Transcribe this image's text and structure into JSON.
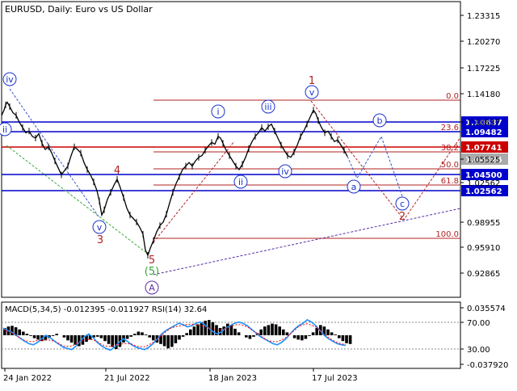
{
  "chart_data": [
    {
      "type": "line",
      "title": "EURUSD, Daily:  Euro vs US Dollar",
      "ylim": [
        0.91,
        1.248
      ],
      "y_ticks": [
        1.23315,
        1.2027,
        1.17225,
        1.1418,
        1.0063,
        1.05525,
        1.0248,
        0.98955,
        0.9591,
        0.92865
      ],
      "y_tick_labels": [
        "1.23315",
        "1.20270",
        "1.17225",
        "1.14180",
        "1.10637",
        "1.05525",
        "1.02562",
        "0.98955",
        "0.95910",
        "0.92865"
      ],
      "price_lines": [
        {
          "label": "1.10637",
          "value": 1.10637,
          "color": "#0000cc"
        },
        {
          "label": "1.09482",
          "value": 1.09482,
          "color": "#0000cc"
        },
        {
          "label": "1.07741",
          "value": 1.07741,
          "color": "#cc0000"
        },
        {
          "label": "1.06525",
          "value": 1.06525,
          "color": "#aaaaaa"
        },
        {
          "label": "1.04500",
          "value": 1.045,
          "color": "#0000cc"
        },
        {
          "label": "1.02562",
          "value": 1.02562,
          "color": "#0000cc"
        }
      ],
      "fib_levels": [
        {
          "label": "0.0",
          "value": 1.1275
        },
        {
          "label": "23.6",
          "value": 1.0915
        },
        {
          "label": "38.2",
          "value": 1.069
        },
        {
          "label": "50.0",
          "value": 1.051
        },
        {
          "label": "61.8",
          "value": 1.033
        },
        {
          "label": "100.0",
          "value": 0.974
        }
      ],
      "x_tick_labels": [
        "24 Jan 2022",
        "21 Jul 2022",
        "18 Jan 2023",
        "17 Jul 2023"
      ],
      "wave_labels": [
        {
          "text": "iv",
          "style": "circle-blue"
        },
        {
          "text": "ii",
          "style": "circle-blue"
        },
        {
          "text": "v",
          "style": "circle-blue"
        },
        {
          "text": "3",
          "style": "red"
        },
        {
          "text": "4",
          "style": "red"
        },
        {
          "text": "5",
          "style": "red"
        },
        {
          "text": "(5)",
          "style": "green"
        },
        {
          "text": "A",
          "style": "circle-purple"
        },
        {
          "text": "i",
          "style": "circle-blue"
        },
        {
          "text": "iii",
          "style": "circle-blue"
        },
        {
          "text": "ii",
          "style": "circle-blue"
        },
        {
          "text": "iv",
          "style": "circle-blue"
        },
        {
          "text": "v",
          "style": "circle-blue"
        },
        {
          "text": "1",
          "style": "red"
        },
        {
          "text": "a",
          "style": "circle-blue"
        },
        {
          "text": "b",
          "style": "circle-blue"
        },
        {
          "text": "c",
          "style": "circle-blue"
        },
        {
          "text": "2",
          "style": "red"
        }
      ],
      "price_path": [
        {
          "x": 0,
          "y": 1.118
        },
        {
          "x": 3,
          "y": 1.124
        },
        {
          "x": 5,
          "y": 1.13
        },
        {
          "x": 7,
          "y": 1.133
        },
        {
          "x": 10,
          "y": 1.128
        },
        {
          "x": 14,
          "y": 1.121
        },
        {
          "x": 18,
          "y": 1.118
        },
        {
          "x": 22,
          "y": 1.11
        },
        {
          "x": 26,
          "y": 1.104
        },
        {
          "x": 30,
          "y": 1.098
        },
        {
          "x": 34,
          "y": 1.1
        },
        {
          "x": 38,
          "y": 1.094
        },
        {
          "x": 42,
          "y": 1.092
        },
        {
          "x": 46,
          "y": 1.097
        },
        {
          "x": 50,
          "y": 1.086
        },
        {
          "x": 54,
          "y": 1.079
        },
        {
          "x": 58,
          "y": 1.082
        },
        {
          "x": 62,
          "y": 1.075
        },
        {
          "x": 66,
          "y": 1.066
        },
        {
          "x": 70,
          "y": 1.058
        },
        {
          "x": 74,
          "y": 1.05
        },
        {
          "x": 78,
          "y": 1.055
        },
        {
          "x": 82,
          "y": 1.06
        },
        {
          "x": 86,
          "y": 1.072
        },
        {
          "x": 90,
          "y": 1.082
        },
        {
          "x": 94,
          "y": 1.079
        },
        {
          "x": 98,
          "y": 1.075
        },
        {
          "x": 102,
          "y": 1.064
        },
        {
          "x": 106,
          "y": 1.056
        },
        {
          "x": 110,
          "y": 1.05
        },
        {
          "x": 114,
          "y": 1.042
        },
        {
          "x": 118,
          "y": 1.032
        },
        {
          "x": 121,
          "y": 1.02
        },
        {
          "x": 124,
          "y": 1.004
        },
        {
          "x": 127,
          "y": 1.01
        },
        {
          "x": 131,
          "y": 1.022
        },
        {
          "x": 135,
          "y": 1.03
        },
        {
          "x": 139,
          "y": 1.038
        },
        {
          "x": 143,
          "y": 1.045
        },
        {
          "x": 147,
          "y": 1.035
        },
        {
          "x": 151,
          "y": 1.024
        },
        {
          "x": 155,
          "y": 1.012
        },
        {
          "x": 159,
          "y": 1.004
        },
        {
          "x": 163,
          "y": 1.0
        },
        {
          "x": 167,
          "y": 0.996
        },
        {
          "x": 171,
          "y": 0.99
        },
        {
          "x": 175,
          "y": 0.982
        },
        {
          "x": 178,
          "y": 0.964
        },
        {
          "x": 181,
          "y": 0.958
        },
        {
          "x": 184,
          "y": 0.966
        },
        {
          "x": 188,
          "y": 0.975
        },
        {
          "x": 192,
          "y": 0.985
        },
        {
          "x": 196,
          "y": 0.992
        },
        {
          "x": 200,
          "y": 0.996
        },
        {
          "x": 204,
          "y": 1.005
        },
        {
          "x": 208,
          "y": 1.018
        },
        {
          "x": 212,
          "y": 1.03
        },
        {
          "x": 216,
          "y": 1.04
        },
        {
          "x": 220,
          "y": 1.048
        },
        {
          "x": 224,
          "y": 1.056
        },
        {
          "x": 228,
          "y": 1.06
        },
        {
          "x": 232,
          "y": 1.064
        },
        {
          "x": 236,
          "y": 1.06
        },
        {
          "x": 240,
          "y": 1.066
        },
        {
          "x": 244,
          "y": 1.07
        },
        {
          "x": 248,
          "y": 1.072
        },
        {
          "x": 252,
          "y": 1.078
        },
        {
          "x": 256,
          "y": 1.083
        },
        {
          "x": 260,
          "y": 1.087
        },
        {
          "x": 264,
          "y": 1.085
        },
        {
          "x": 268,
          "y": 1.094
        },
        {
          "x": 271,
          "y": 1.092
        },
        {
          "x": 274,
          "y": 1.086
        },
        {
          "x": 278,
          "y": 1.078
        },
        {
          "x": 282,
          "y": 1.072
        },
        {
          "x": 286,
          "y": 1.066
        },
        {
          "x": 290,
          "y": 1.06
        },
        {
          "x": 294,
          "y": 1.056
        },
        {
          "x": 298,
          "y": 1.062
        },
        {
          "x": 302,
          "y": 1.07
        },
        {
          "x": 306,
          "y": 1.08
        },
        {
          "x": 310,
          "y": 1.088
        },
        {
          "x": 314,
          "y": 1.094
        },
        {
          "x": 318,
          "y": 1.098
        },
        {
          "x": 322,
          "y": 1.104
        },
        {
          "x": 326,
          "y": 1.1
        },
        {
          "x": 330,
          "y": 1.105
        },
        {
          "x": 334,
          "y": 1.108
        },
        {
          "x": 338,
          "y": 1.1
        },
        {
          "x": 342,
          "y": 1.092
        },
        {
          "x": 346,
          "y": 1.084
        },
        {
          "x": 350,
          "y": 1.078
        },
        {
          "x": 354,
          "y": 1.072
        },
        {
          "x": 358,
          "y": 1.07
        },
        {
          "x": 362,
          "y": 1.076
        },
        {
          "x": 366,
          "y": 1.084
        },
        {
          "x": 370,
          "y": 1.094
        },
        {
          "x": 374,
          "y": 1.1
        },
        {
          "x": 378,
          "y": 1.108
        },
        {
          "x": 382,
          "y": 1.116
        },
        {
          "x": 386,
          "y": 1.124
        },
        {
          "x": 389,
          "y": 1.12
        },
        {
          "x": 392,
          "y": 1.112
        },
        {
          "x": 396,
          "y": 1.104
        },
        {
          "x": 400,
          "y": 1.098
        },
        {
          "x": 404,
          "y": 1.1
        },
        {
          "x": 408,
          "y": 1.094
        },
        {
          "x": 412,
          "y": 1.088
        },
        {
          "x": 416,
          "y": 1.09
        },
        {
          "x": 420,
          "y": 1.084
        },
        {
          "x": 424,
          "y": 1.078
        },
        {
          "x": 428,
          "y": 1.071
        }
      ],
      "forecast_path": [
        {
          "x": 428,
          "y": 1.071
        },
        {
          "x": 440,
          "y": 1.046
        },
        {
          "x": 470,
          "y": 1.094
        },
        {
          "x": 498,
          "y": 1.02
        }
      ]
    },
    {
      "type": "line",
      "title": "MACD(5,34,5) -0.012395 -0.011927 RSI(14) 32.64",
      "y_tick_labels": [
        "0.035574",
        "70.00",
        "30.00",
        "-0.037920"
      ],
      "rsi_levels": [
        70,
        30
      ],
      "macd_histogram": [
        0.01,
        0.012,
        0.013,
        0.011,
        0.008,
        0.005,
        0.002,
        -0.001,
        -0.004,
        -0.006,
        -0.008,
        -0.007,
        -0.004,
        -0.001,
        0.002,
        0.0,
        -0.003,
        -0.007,
        -0.01,
        -0.013,
        -0.015,
        -0.013,
        -0.009,
        -0.006,
        -0.003,
        -0.002,
        -0.004,
        -0.008,
        -0.012,
        -0.016,
        -0.019,
        -0.016,
        -0.01,
        -0.005,
        -0.002,
        0.002,
        0.005,
        0.004,
        0.001,
        -0.003,
        -0.007,
        -0.01,
        -0.012,
        -0.015,
        -0.018,
        -0.016,
        -0.011,
        -0.006,
        -0.002,
        0.003,
        0.008,
        0.012,
        0.015,
        0.018,
        0.02,
        0.021,
        0.018,
        0.014,
        0.01,
        0.012,
        0.016,
        0.014,
        0.009,
        0.004,
        0.0,
        -0.003,
        -0.005,
        -0.002,
        0.003,
        0.008,
        0.012,
        0.014,
        0.016,
        0.015,
        0.012,
        0.008,
        0.004,
        0.0,
        -0.004,
        -0.006,
        -0.007,
        -0.005,
        -0.001,
        0.004,
        0.01,
        0.014,
        0.012,
        0.008,
        0.004,
        0.001,
        -0.004,
        -0.008,
        -0.011,
        -0.012
      ],
      "rsi_values": [
        62,
        58,
        55,
        50,
        45,
        40,
        36,
        34,
        38,
        44,
        50,
        46,
        40,
        35,
        30,
        28,
        26,
        32,
        40,
        48,
        52,
        46,
        38,
        32,
        28,
        25,
        30,
        38,
        44,
        40,
        34,
        30,
        28,
        26,
        30,
        36,
        44,
        52,
        58,
        62,
        66,
        70,
        68,
        64,
        66,
        70,
        72,
        68,
        62,
        56,
        52,
        56,
        62,
        66,
        70,
        72,
        70,
        66,
        60,
        54,
        48,
        44,
        40,
        36,
        34,
        38,
        44,
        52,
        60,
        66,
        70,
        76,
        72,
        66,
        58,
        50,
        44,
        40,
        36,
        34,
        33
      ]
    }
  ],
  "colors": {
    "price": "#000000",
    "fib": "#b22222",
    "blue_line": "#0000cc",
    "red_line": "#cc0000",
    "macd_hist": "#000000",
    "macd_signal": "#ff0000",
    "rsi": "#1e90ff",
    "purple": "#5a2ea6",
    "green_dashed": "#3aa83a",
    "blue_dashed": "#3355cc"
  }
}
